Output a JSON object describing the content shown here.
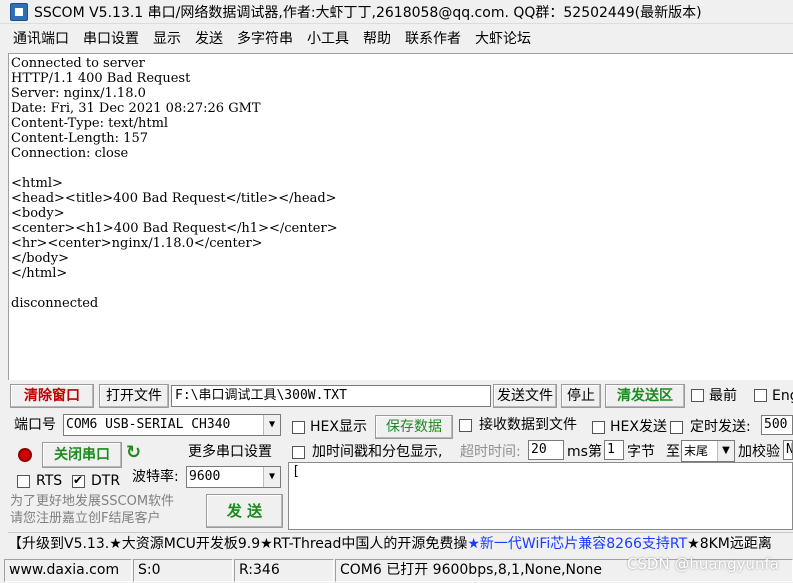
{
  "window": {
    "title": "SSCOM V5.13.1 串口/网络数据调试器,作者:大虾丁丁,2618058@qq.com. QQ群：52502449(最新版本)"
  },
  "menu": [
    "通讯端口",
    "串口设置",
    "显示",
    "发送",
    "多字符串",
    "小工具",
    "帮助",
    "联系作者",
    "大虾论坛"
  ],
  "receive": {
    "lines": [
      "Connected to server",
      "HTTP/1.1 400 Bad Request",
      "Server: nginx/1.18.0",
      "Date: Fri, 31 Dec 2021 08:27:26 GMT",
      "Content-Type: text/html",
      "Content-Length: 157",
      "Connection: close",
      "",
      "<html>",
      "<head><title>400 Bad Request</title></head>",
      "<body>",
      "<center><h1>400 Bad Request</h1></center>",
      "<hr><center>nginx/1.18.0</center>",
      "</body>",
      "</html>",
      "",
      "disconnected"
    ]
  },
  "toolbar": {
    "clear_window": "清除窗口",
    "open_file": "打开文件",
    "file_path": "F:\\串口调试工具\\300W.TXT",
    "send_file": "发送文件",
    "stop": "停止",
    "clear_send": "清发送区",
    "front": "最前",
    "english": "English"
  },
  "port_panel": {
    "port_label": "端口号",
    "port_value": "COM6 USB-SERIAL CH340",
    "close_port": "关闭串口",
    "more_settings": "更多串口设置",
    "rts": "RTS",
    "dtr": "DTR",
    "baud_label": "波特率:",
    "baud_value": "9600",
    "promo": "为了更好地发展SSCOM软件\n请您注册嘉立创F结尾客户",
    "send": "发 送"
  },
  "options": {
    "hex_display": "HEX显示",
    "save_data": "保存数据",
    "receive_to_file": "接收数据到文件",
    "hex_send": "HEX发送",
    "timed_send": "定时发送:",
    "timed_value": "500",
    "timestamp": "加时间戳和分包显示,",
    "timeout_label": "超时时间:",
    "timeout_value": "20",
    "ms": "ms",
    "di": "第",
    "byte_no": "1",
    "byte_label": "字节",
    "to": "至",
    "tail": "末尾",
    "checksum": "加校验",
    "checksum_value": "N"
  },
  "send_area": {
    "content": "["
  },
  "marquee": {
    "part1": "【升级到V5.13.★大资源MCU开发板9.9★RT-Thread中国人的开源免费操",
    "part2": "★新一代WiFi芯片兼容8266支持RT",
    "part3": "★8KM远距离"
  },
  "status": {
    "website": "www.daxia.com",
    "sent": "S:0",
    "received": "R:346",
    "port_info": "COM6 已打开  9600bps,8,1,None,None"
  },
  "watermark": "CSDN @huangyunfa",
  "colors": {
    "red_button": "#c00000",
    "green_button": "#1e8a1e",
    "marquee_blue": "#1a3cff"
  }
}
